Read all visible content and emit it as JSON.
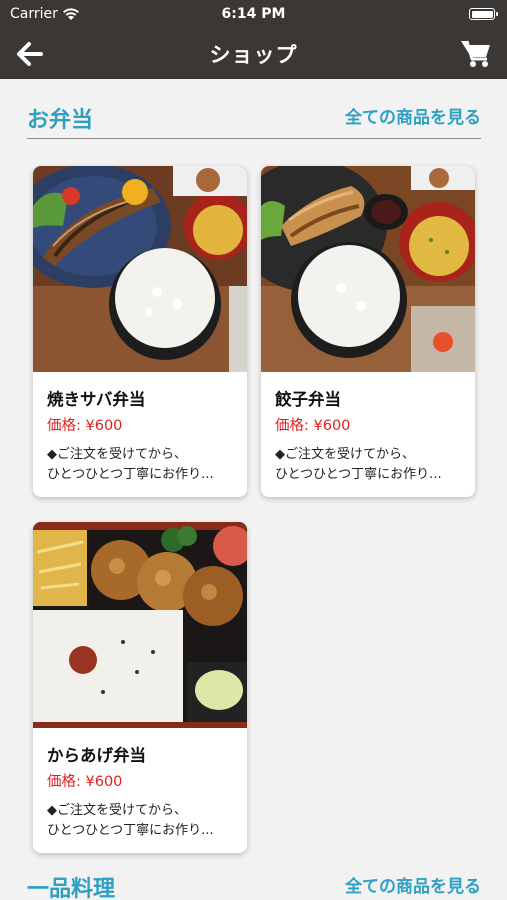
{
  "status": {
    "carrier": "Carrier",
    "time": "6:14 PM"
  },
  "nav": {
    "title": "ショップ",
    "back_icon": "arrow-left-icon",
    "cart_icon": "cart-icon"
  },
  "sections": [
    {
      "title": "お弁当",
      "see_all": "全ての商品を見る"
    },
    {
      "title": "一品料理",
      "see_all": "全ての商品を見る"
    }
  ],
  "products": [
    {
      "name": "焼きサバ弁当",
      "price": "価格: ¥600",
      "desc": "◆ご注文を受けてから、\nひとつひとつ丁寧にお作り..."
    },
    {
      "name": "餃子弁当",
      "price": "価格: ¥600",
      "desc": "◆ご注文を受けてから、\nひとつひとつ丁寧にお作り..."
    },
    {
      "name": "からあげ弁当",
      "price": "価格: ¥600",
      "desc": "◆ご注文を受けてから、\nひとつひとつ丁寧にお作り..."
    }
  ],
  "colors": {
    "nav_bg": "#3a3735",
    "accent": "#2f9fc2",
    "price": "#e02020",
    "background": "#f2f2f2"
  }
}
